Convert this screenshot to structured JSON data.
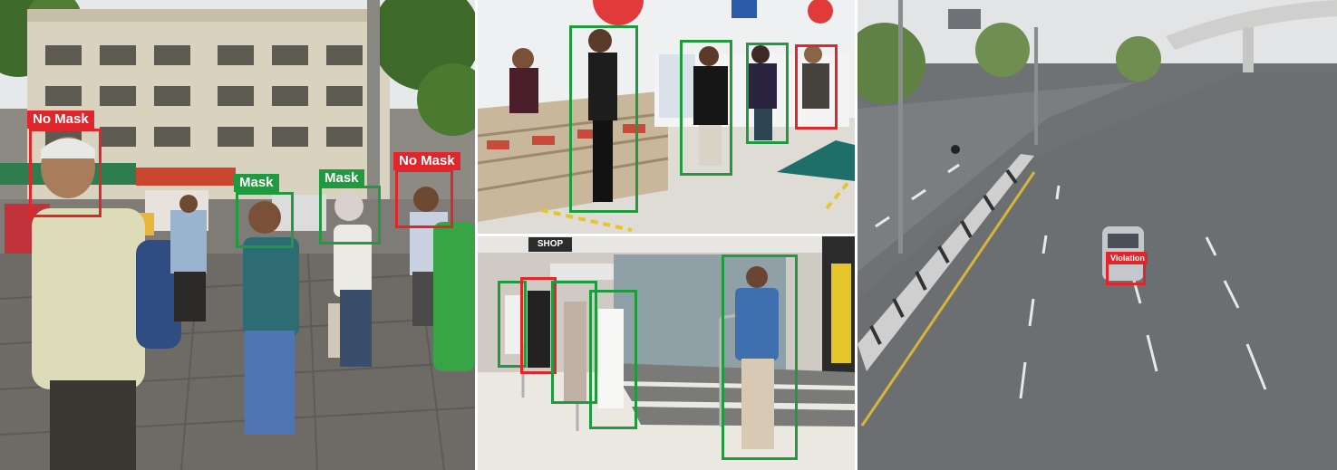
{
  "street_scene": {
    "no_mask_label_1": "No Mask",
    "mask_label_1": "Mask",
    "mask_label_2": "Mask",
    "no_mask_label_2": "No Mask"
  },
  "queue_scene": {
    "shop_sign": "SHOP"
  },
  "highway_scene": {
    "violation_label": "Violation"
  },
  "colors": {
    "compliant_box": "#1f9a3e",
    "violation_box": "#e0262b"
  }
}
